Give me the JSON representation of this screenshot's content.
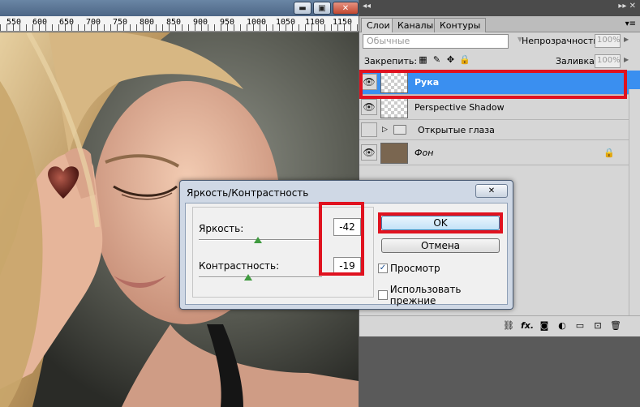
{
  "ruler": {
    "marks": [
      "550",
      "600",
      "650",
      "700",
      "750",
      "800",
      "850",
      "900",
      "950",
      "1000",
      "1050",
      "1100",
      "1150"
    ]
  },
  "window_controls": {
    "minimize": "▬",
    "maximize": "▣",
    "close": "✕"
  },
  "panel": {
    "top_left": "◂◂",
    "top_right": "▸▸ ✕",
    "tabs": [
      "Слои",
      "Каналы",
      "Контуры"
    ],
    "menu_icon": "▾≡",
    "blend_mode": "Обычные",
    "opacity_label": "Непрозрачность:",
    "opacity_value": "100%",
    "lock_label": "Закрепить:",
    "fill_label": "Заливка:",
    "fill_value": "100%",
    "layers": [
      {
        "name": "Рука",
        "selected": true,
        "visible": true
      },
      {
        "name": "Perspective Shadow",
        "selected": false,
        "visible": true
      },
      {
        "name": "Открытые глаза",
        "selected": false,
        "visible": false,
        "group": true
      },
      {
        "name": "Фон",
        "selected": false,
        "visible": true,
        "locked": true
      }
    ],
    "bottom_icons": [
      "⛓",
      "fx.",
      "◙",
      "◐",
      "▭",
      "⊡",
      "🗑"
    ]
  },
  "dialog": {
    "title": "Яркость/Контрастность",
    "close": "✕",
    "brightness_label": "Яркость:",
    "brightness_value": "-42",
    "contrast_label": "Контрастность:",
    "contrast_value": "-19",
    "ok_label": "OK",
    "cancel_label": "Отмена",
    "preview_label": "Просмотр",
    "preview_checked": true,
    "use_legacy_label": "Использовать прежние",
    "use_legacy_checked": false,
    "check_mark": "✓"
  },
  "colors": {
    "highlight": "#e0121f",
    "selection": "#3a8ff0"
  }
}
